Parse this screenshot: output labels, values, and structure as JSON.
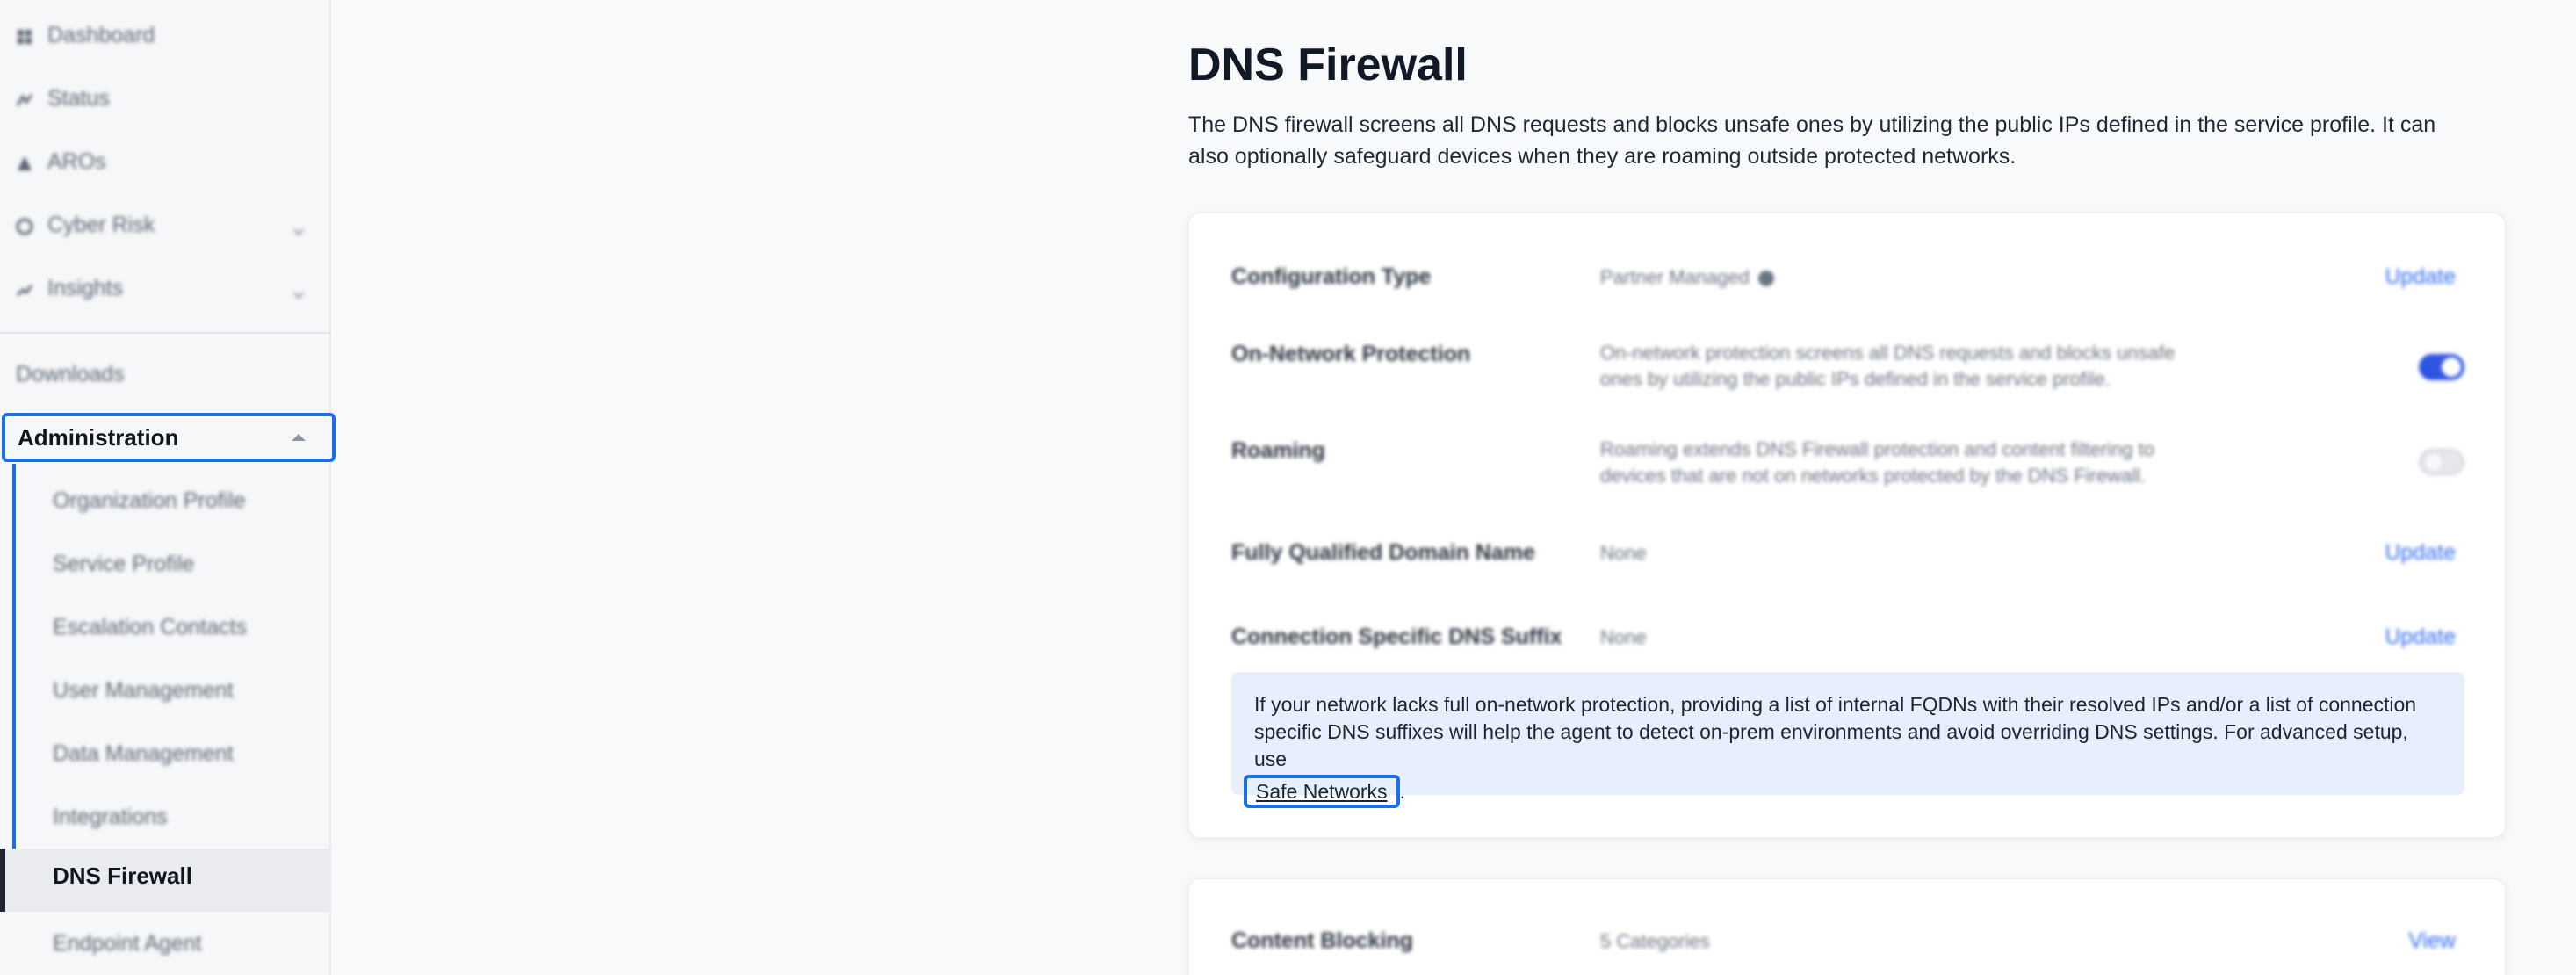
{
  "sidebar": {
    "items": [
      {
        "label": "Dashboard",
        "icon": "dashboard-icon"
      },
      {
        "label": "Status",
        "icon": "status-icon"
      },
      {
        "label": "AROs",
        "icon": "aros-icon"
      },
      {
        "label": "Cyber Risk",
        "icon": "cyber-risk-icon"
      },
      {
        "label": "Insights",
        "icon": "insights-icon"
      }
    ],
    "downloads": "Downloads",
    "administration": {
      "label": "Administration",
      "children": [
        "Organization Profile",
        "Service Profile",
        "Escalation Contacts",
        "User Management",
        "Data Management",
        "Integrations",
        "DNS Firewall",
        "Endpoint Agent"
      ]
    }
  },
  "main": {
    "title": "DNS Firewall",
    "description": "The DNS firewall screens all DNS requests and blocks unsafe ones by utilizing the public IPs defined in the service profile. It can also optionally safeguard devices when they are roaming outside protected networks.",
    "rows": [
      {
        "label": "Configuration Type",
        "value": "Partner Managed",
        "action": "Update"
      },
      {
        "label": "On-Network Protection",
        "value": "On-network protection screens all DNS requests and blocks unsafe ones by utilizing the public IPs defined in the service profile.",
        "toggle": true
      },
      {
        "label": "Roaming",
        "value": "Roaming extends DNS Firewall protection and content filtering to devices that are not on networks protected by the DNS Firewall.",
        "toggle": false
      },
      {
        "label": "Fully Qualified Domain Name",
        "value": "None",
        "action": "Update"
      },
      {
        "label": "Connection Specific DNS Suffix",
        "value": "None",
        "action": "Update"
      }
    ],
    "notice": {
      "text": "If your network lacks full on-network protection, providing a list of internal FQDNs with their resolved IPs and/or a list of connection specific DNS suffixes will help the agent to detect on-prem environments and avoid overriding DNS settings. For advanced setup, use",
      "link": "Safe Networks",
      "suffix": "."
    },
    "content_blocking": {
      "label": "Content Blocking",
      "value": "5 Categories",
      "action": "View"
    }
  },
  "colors": {
    "accent": "#1a6fe8",
    "link": "#2f6cf0",
    "toggle_on": "#2f55e0",
    "notice_bg": "#e7effc"
  }
}
